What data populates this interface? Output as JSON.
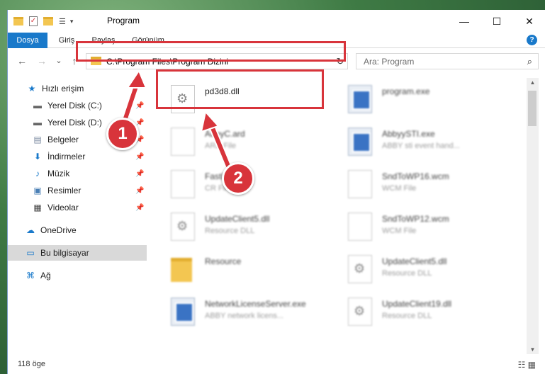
{
  "window": {
    "title": "Program",
    "minimize": "—",
    "maximize": "☐",
    "close": "✕"
  },
  "ribbon": {
    "tabs": [
      "Dosya",
      "Giriş",
      "Paylaş",
      "Görünüm"
    ],
    "help": "?"
  },
  "nav": {
    "back": "←",
    "forward": "→",
    "recent": "⌄",
    "up": "↑",
    "address": "C:\\Program Files\\Program Dizini",
    "address_drop": "⌄",
    "refresh": "↻",
    "search_placeholder": "Ara: Program",
    "search_icon": "⌕"
  },
  "sidebar": {
    "items": [
      {
        "label": "Hızlı erişim",
        "icon": "★"
      },
      {
        "label": "Yerel Disk (C:)",
        "icon": "▬"
      },
      {
        "label": "Yerel Disk (D:)",
        "icon": "▬"
      },
      {
        "label": "Belgeler",
        "icon": "▤"
      },
      {
        "label": "İndirmeler",
        "icon": "⬇"
      },
      {
        "label": "Müzik",
        "icon": "♪"
      },
      {
        "label": "Resimler",
        "icon": "▣"
      },
      {
        "label": "Videolar",
        "icon": "▦"
      },
      {
        "label": "OneDrive",
        "icon": "☁"
      },
      {
        "label": "Bu bilgisayar",
        "icon": "▭"
      },
      {
        "label": "Ağ",
        "icon": "⌘"
      }
    ],
    "pin": "📌"
  },
  "files": [
    {
      "name": "pd3d8.dll",
      "desc": "",
      "type": "dll"
    },
    {
      "name": "program.exe",
      "desc": "",
      "type": "exe"
    },
    {
      "name": "AbbyC.ard",
      "desc": "ARD File",
      "type": "blank"
    },
    {
      "name": "AbbyySTI.exe",
      "desc": "ABBY sti event hand...",
      "type": "exe"
    },
    {
      "name": "FastFonts",
      "desc": "CR Fil",
      "type": "blank"
    },
    {
      "name": "SndToWP16.wcm",
      "desc": "WCM File",
      "type": "blank"
    },
    {
      "name": "UpdateClient5.dll",
      "desc": "Resource DLL",
      "type": "dll"
    },
    {
      "name": "SndToWP12.wcm",
      "desc": "WCM File",
      "type": "blank"
    },
    {
      "name": "Resource",
      "desc": "",
      "type": "folder"
    },
    {
      "name": "UpdateClient5.dll",
      "desc": "Resource DLL",
      "type": "dll"
    },
    {
      "name": "NetworkLicenseServer.exe",
      "desc": "ABBY network licens...",
      "type": "exe"
    },
    {
      "name": "UpdateClient19.dll",
      "desc": "Resource DLL",
      "type": "dll"
    }
  ],
  "status": {
    "count": "118 öge",
    "view_icons": "☷ ▦"
  },
  "markers": {
    "one": "1",
    "two": "2"
  },
  "colors": {
    "accent": "#1979ca",
    "highlight": "#d8343b"
  }
}
